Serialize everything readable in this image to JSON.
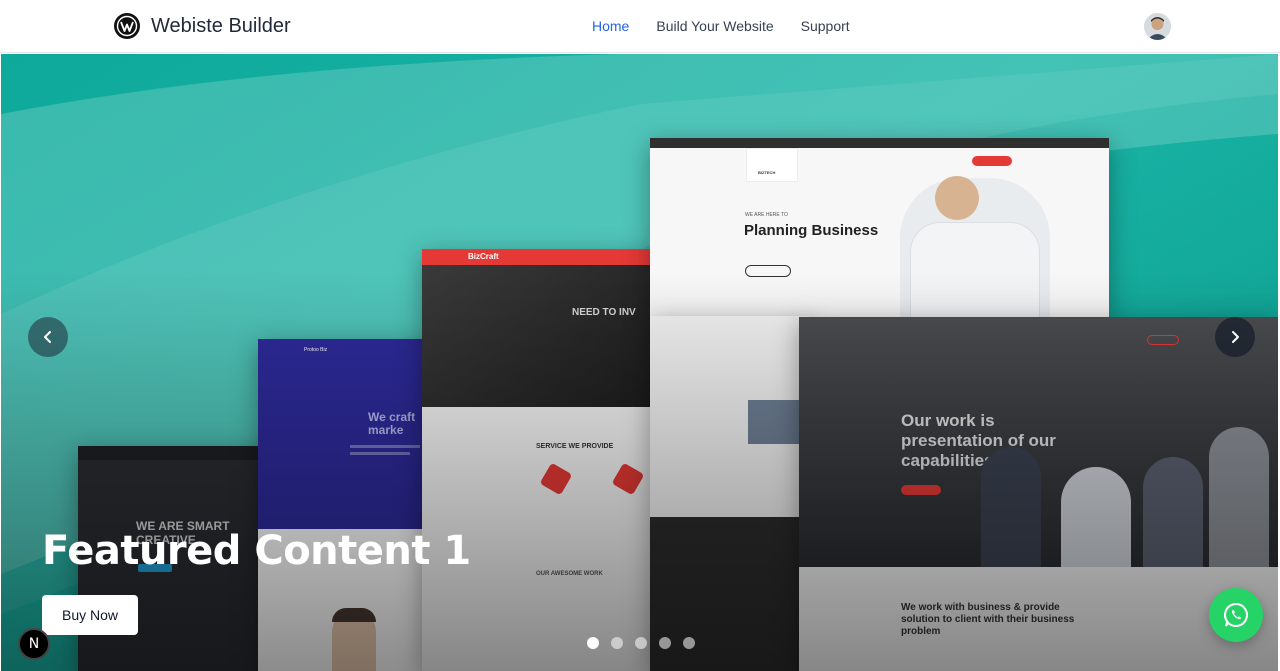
{
  "header": {
    "brand": "Webiste Builder",
    "nav": [
      {
        "label": "Home",
        "active": true
      },
      {
        "label": "Build Your Website",
        "active": false
      },
      {
        "label": "Support",
        "active": false
      }
    ]
  },
  "hero": {
    "title": "Featured Content 1",
    "button_label": "Buy Now",
    "slide_count": 5,
    "active_slide": 1,
    "mockups": {
      "planning": {
        "eyebrow": "WE ARE HERE TO",
        "heading": "Planning Business",
        "brand": "BIZTECH"
      },
      "bizcraft": {
        "brand": "BizCraft",
        "headline": "NEED TO INV",
        "service": "SERVICE WE PROVIDE",
        "work": "OUR AWESOME WORK"
      },
      "blue": {
        "brand": "Protoo Biz",
        "headline": "We craft marke"
      },
      "dark": {
        "headline": "WE ARE SMART CREATIVE"
      },
      "work": {
        "line1": "Our work is",
        "line2": "presentation of our",
        "line3": "capabilities.",
        "footer": "We work with business & provide solution to client with their business problem"
      }
    }
  },
  "colors": {
    "accent": "#2563eb",
    "whatsapp": "#25d366",
    "hero_teal": "#1ab5a6"
  },
  "icons": {
    "logo": "wordpress-icon",
    "prev": "chevron-left-icon",
    "next": "chevron-right-icon",
    "chat": "whatsapp-icon"
  },
  "badge": "N"
}
